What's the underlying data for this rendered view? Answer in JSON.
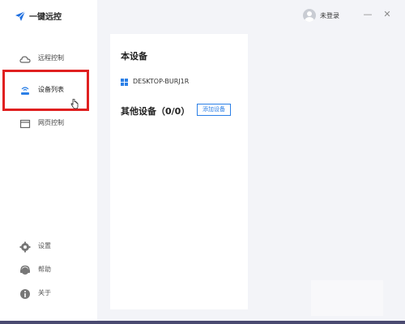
{
  "app": {
    "title": "一键远控",
    "accent_color": "#2b7fe6",
    "highlight_color": "#e02020"
  },
  "sidebar": {
    "items": [
      {
        "label": "远程控制",
        "icon": "cloud-icon"
      },
      {
        "label": "设备列表",
        "icon": "device-list-icon",
        "active": true
      },
      {
        "label": "网页控制",
        "icon": "browser-window-icon"
      }
    ],
    "bottom_items": [
      {
        "label": "设置",
        "icon": "gear-icon"
      },
      {
        "label": "帮助",
        "icon": "help-headset-icon"
      },
      {
        "label": "关于",
        "icon": "info-icon"
      }
    ]
  },
  "topbar": {
    "user_label": "未登录",
    "minimize_glyph": "—",
    "close_glyph": "✕"
  },
  "main": {
    "this_device_title": "本设备",
    "this_device_name": "DESKTOP-BURJ1R",
    "other_devices_title": "其他设备（0/0）",
    "add_device_button": "添加设备"
  }
}
